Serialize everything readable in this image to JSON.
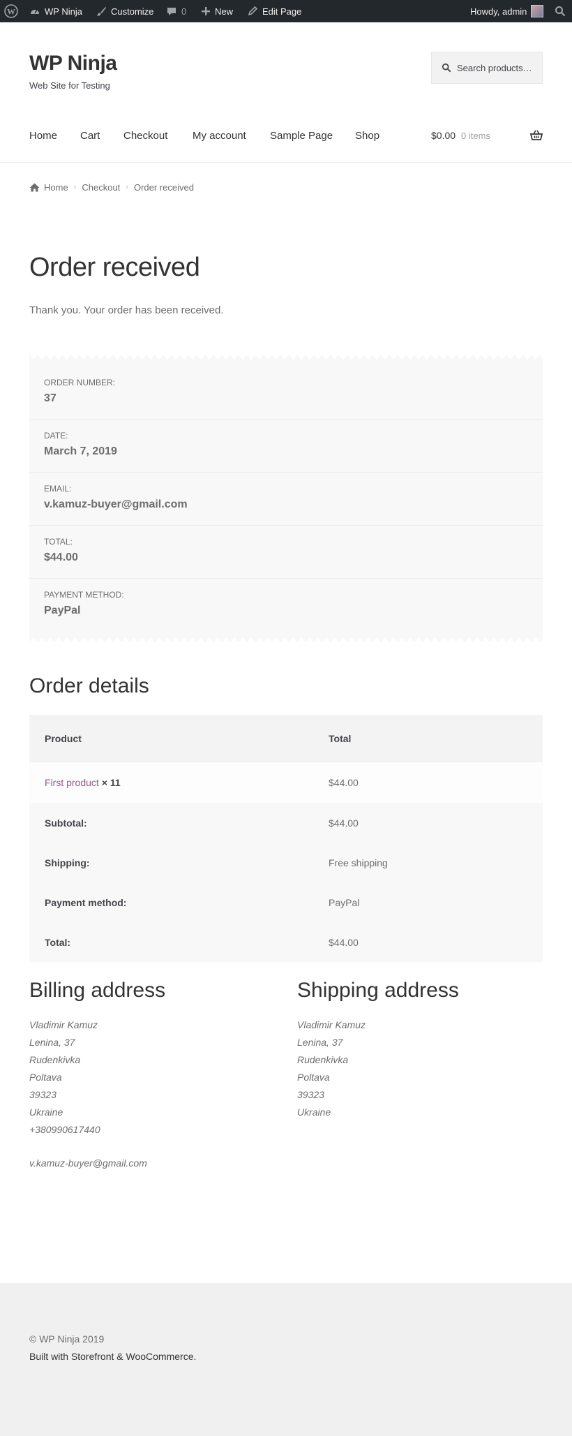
{
  "admin_bar": {
    "site_name": "WP Ninja",
    "customize": "Customize",
    "comments_count": "0",
    "new": "New",
    "edit_page": "Edit Page",
    "howdy": "Howdy, admin"
  },
  "header": {
    "site_title": "WP Ninja",
    "site_description": "Web Site for Testing",
    "search_placeholder": "Search products…"
  },
  "nav": {
    "items": [
      "Home",
      "Cart",
      "Checkout",
      "My account",
      "Sample Page",
      "Shop"
    ],
    "cart_amount": "$0.00",
    "cart_items": "0 items"
  },
  "breadcrumb": [
    "Home",
    "Checkout",
    "Order received"
  ],
  "page": {
    "title": "Order received",
    "thanks": "Thank you. Your order has been received."
  },
  "overview": [
    {
      "label": "Order number:",
      "value": "37"
    },
    {
      "label": "Date:",
      "value": "March 7, 2019"
    },
    {
      "label": "Email:",
      "value": "v.kamuz-buyer@gmail.com"
    },
    {
      "label": "Total:",
      "value": "$44.00"
    },
    {
      "label": "Payment method:",
      "value": "PayPal"
    }
  ],
  "order_details": {
    "title": "Order details",
    "headers": [
      "Product",
      "Total"
    ],
    "product": {
      "name": "First product",
      "qty": "× 11",
      "total": "$44.00"
    },
    "rows": [
      {
        "label": "Subtotal:",
        "value": "$44.00"
      },
      {
        "label": "Shipping:",
        "value": "Free shipping"
      },
      {
        "label": "Payment method:",
        "value": "PayPal"
      },
      {
        "label": "Total:",
        "value": "$44.00"
      }
    ]
  },
  "billing": {
    "title": "Billing address",
    "lines": [
      "Vladimir Kamuz",
      "Lenina, 37",
      "Rudenkivka",
      "Poltava",
      "39323",
      "Ukraine"
    ],
    "phone": "+380990617440",
    "email": "v.kamuz-buyer@gmail.com"
  },
  "shipping": {
    "title": "Shipping address",
    "lines": [
      "Vladimir Kamuz",
      "Lenina, 37",
      "Rudenkivka",
      "Poltava",
      "39323",
      "Ukraine"
    ]
  },
  "footer": {
    "copyright": "© WP Ninja 2019",
    "built_with": "Built with Storefront & WooCommerce."
  },
  "colors": {
    "admin_bar": "#23282d",
    "link": "#96588a",
    "panel": "#f8f8f8",
    "footer": "#f0f0f0"
  }
}
